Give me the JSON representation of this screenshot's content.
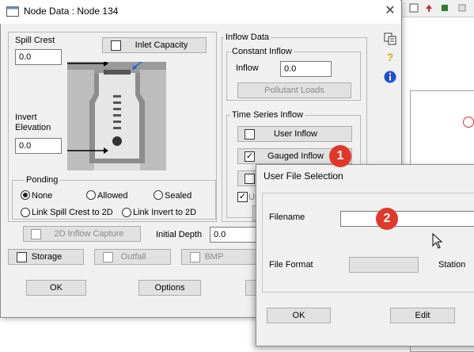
{
  "dialog": {
    "title": "Node Data : Node 134",
    "close_glyph": "✕"
  },
  "left_panel": {
    "spill_crest_label": "Spill Crest",
    "spill_crest_value": "0.0",
    "inlet_capacity_label": "Inlet Capacity",
    "invert_label_line1": "Invert",
    "invert_label_line2": "Elevation",
    "invert_value": "0.0"
  },
  "ponding": {
    "legend": "Ponding",
    "options": [
      "None",
      "Allowed",
      "Sealed",
      "Link Spill Crest to 2D",
      "Link Invert to 2D"
    ],
    "selected": "None"
  },
  "inflow_capture": {
    "label": "2D Inflow Capture",
    "initial_depth_label": "Initial Depth",
    "initial_depth_value": "0.0"
  },
  "bottom_checks": {
    "storage": "Storage",
    "outfall": "Outfall",
    "bmp": "BMP"
  },
  "buttons": {
    "ok": "OK",
    "options": "Options"
  },
  "inflow_data": {
    "legend": "Inflow Data",
    "constant_inflow_legend": "Constant Inflow",
    "inflow_label": "Inflow",
    "inflow_value": "0.0",
    "pollutant_loads": "Pollutant Loads",
    "time_series_legend": "Time Series Inflow",
    "user_inflow": "User Inflow",
    "gauged_inflow": "Gauged Inflow",
    "gauged_checked": true,
    "partial_checkbox_label": "Us"
  },
  "side_icons": [
    "copy-icon",
    "help-icon",
    "info-icon"
  ],
  "file_dialog": {
    "title": "User File Selection",
    "filename_label": "Filename",
    "filename_value": "",
    "file_format_label": "File Format",
    "file_format_value": "",
    "station_label": "Station",
    "ok": "OK",
    "edit": "Edit"
  },
  "callouts": [
    "1",
    "2"
  ],
  "colors": {
    "callout": "#e0392b",
    "dialog_bg": "#f0f0f0",
    "info_blue": "#1a4fd6",
    "help_yellow": "#d4b000"
  }
}
